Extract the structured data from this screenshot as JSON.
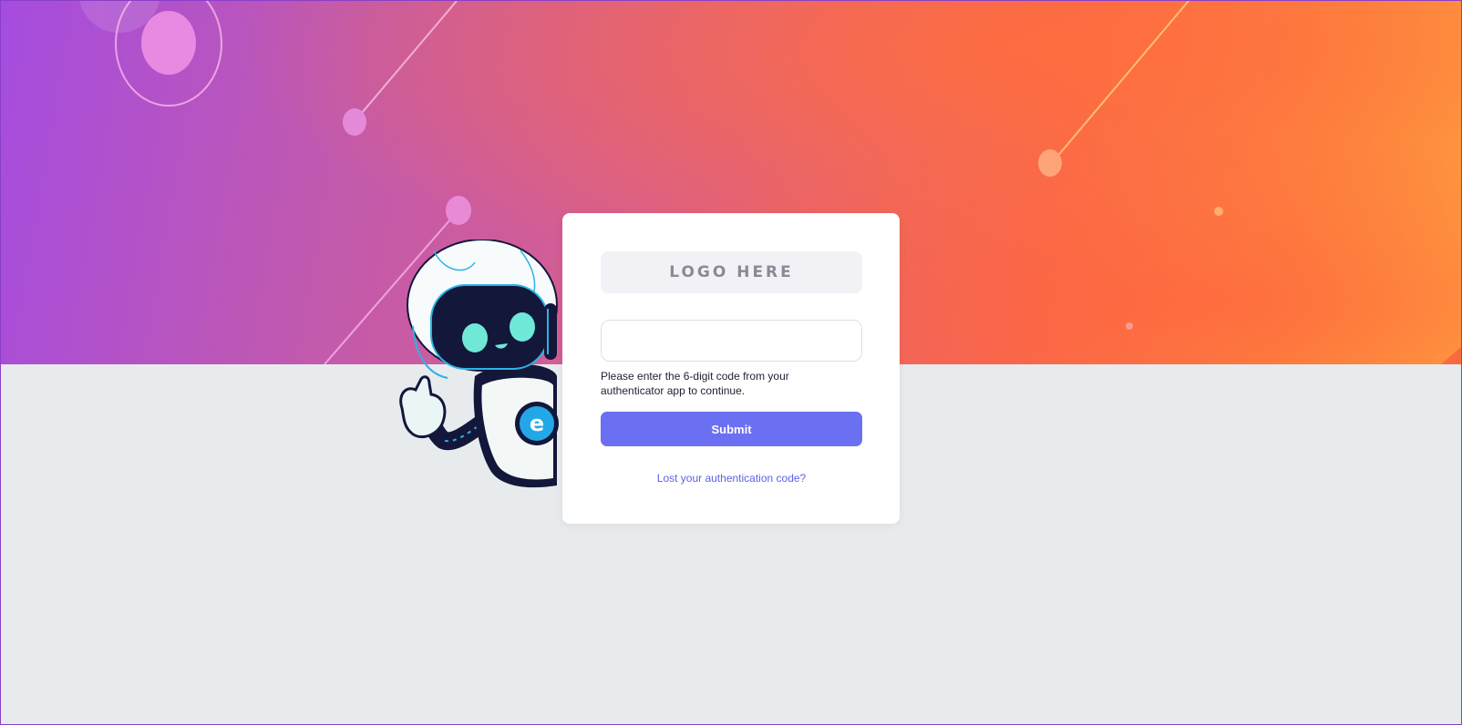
{
  "login": {
    "logo_text": "LOGO HERE",
    "code_value": "",
    "hint_text": "Please enter the 6-digit code from your authenticator app to continue.",
    "submit_label": "Submit",
    "lost_code_link": "Lost your authentication code?"
  },
  "colors": {
    "accent": "#6b6ff2",
    "link": "#5c62e8",
    "page_background": "#e8ebee"
  },
  "mascot": {
    "emblem_letter": "e"
  }
}
